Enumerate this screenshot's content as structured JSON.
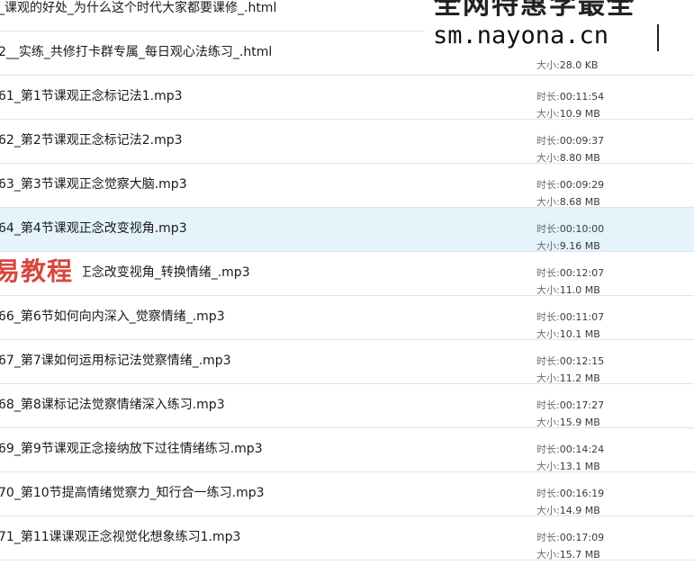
{
  "watermark": {
    "line1": "全网特惠学最全",
    "line2": "sm.nayona.cn",
    "stamp": "易教程"
  },
  "labels": {
    "duration": "时长: ",
    "size": "大小: "
  },
  "files": [
    {
      "name": "_课观的好处_为什么这个时代大家都要课修_.html",
      "duration": "",
      "size": ""
    },
    {
      "name": "2__实练_共修打卡群专属_每日观心法练习_.html",
      "duration": "",
      "size": "28.0 KB"
    },
    {
      "name": "61_第1节课观正念标记法1.mp3",
      "duration": "00:11:54",
      "size": "10.9 MB"
    },
    {
      "name": "62_第2节课观正念标记法2.mp3",
      "duration": "00:09:37",
      "size": "8.80 MB"
    },
    {
      "name": "63_第3节课观正念觉察大脑.mp3",
      "duration": "00:09:29",
      "size": "8.68 MB"
    },
    {
      "name": "64_第4节课观正念改变视角.mp3",
      "duration": "00:10:00",
      "size": "9.16 MB",
      "selected": true
    },
    {
      "name": "65_第5节课观正念改变视角_转换情绪_.mp3",
      "duration": "00:12:07",
      "size": "11.0 MB"
    },
    {
      "name": "66_第6节如何向内深入_觉察情绪_.mp3",
      "duration": "00:11:07",
      "size": "10.1 MB"
    },
    {
      "name": "67_第7课如何运用标记法觉察情绪_.mp3",
      "duration": "00:12:15",
      "size": "11.2 MB"
    },
    {
      "name": "68_第8课标记法觉察情绪深入练习.mp3",
      "duration": "00:17:27",
      "size": "15.9 MB"
    },
    {
      "name": "69_第9节课观正念接纳放下过往情绪练习.mp3",
      "duration": "00:14:24",
      "size": "13.1 MB"
    },
    {
      "name": "70_第10节提高情绪觉察力_知行合一练习.mp3",
      "duration": "00:16:19",
      "size": "14.9 MB"
    },
    {
      "name": "71_第11课课观正念视觉化想象练习1.mp3",
      "duration": "00:17:09",
      "size": "15.7 MB"
    }
  ]
}
